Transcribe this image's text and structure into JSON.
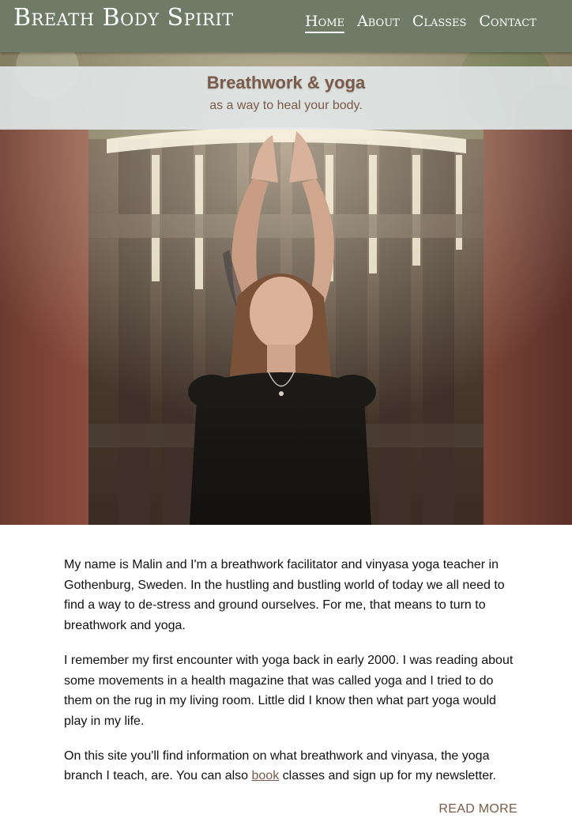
{
  "header": {
    "brand": "Breath Body Spirit",
    "nav": [
      {
        "label": "Home",
        "active": true
      },
      {
        "label": "About",
        "active": false
      },
      {
        "label": "Classes",
        "active": false
      },
      {
        "label": "Contact",
        "active": false
      }
    ]
  },
  "hero": {
    "title": "Breathwork & yoga",
    "subtitle": "as a way to heal your body."
  },
  "content": {
    "paragraph_1": "My name is Malin and I'm a breathwork facilitator and vinyasa yoga teacher in Gothenburg, Sweden. In the hustling and bustling world of today we all need to find a way to de-stress and ground ourselves. For me, that means to turn to breathwork and yoga.",
    "paragraph_2": "I remember my first encounter with yoga back in early 2000. I was reading about some movements in a health magazine that was called yoga and I tried to do them on the rug in my living room. Little did I know then what part yoga would play in my life.",
    "paragraph_3_before_link": "On this site you'll find information on what breathwork and vinyasa, the yoga branch I teach, are. You can also ",
    "paragraph_3_link": "book",
    "paragraph_3_after_link": " classes and sign up for my newsletter.",
    "read_more": "READ MORE"
  },
  "colors": {
    "header_bg": "#6f7b66",
    "accent_brown": "#7a5a48",
    "band_bg": "#e2e8ea"
  }
}
